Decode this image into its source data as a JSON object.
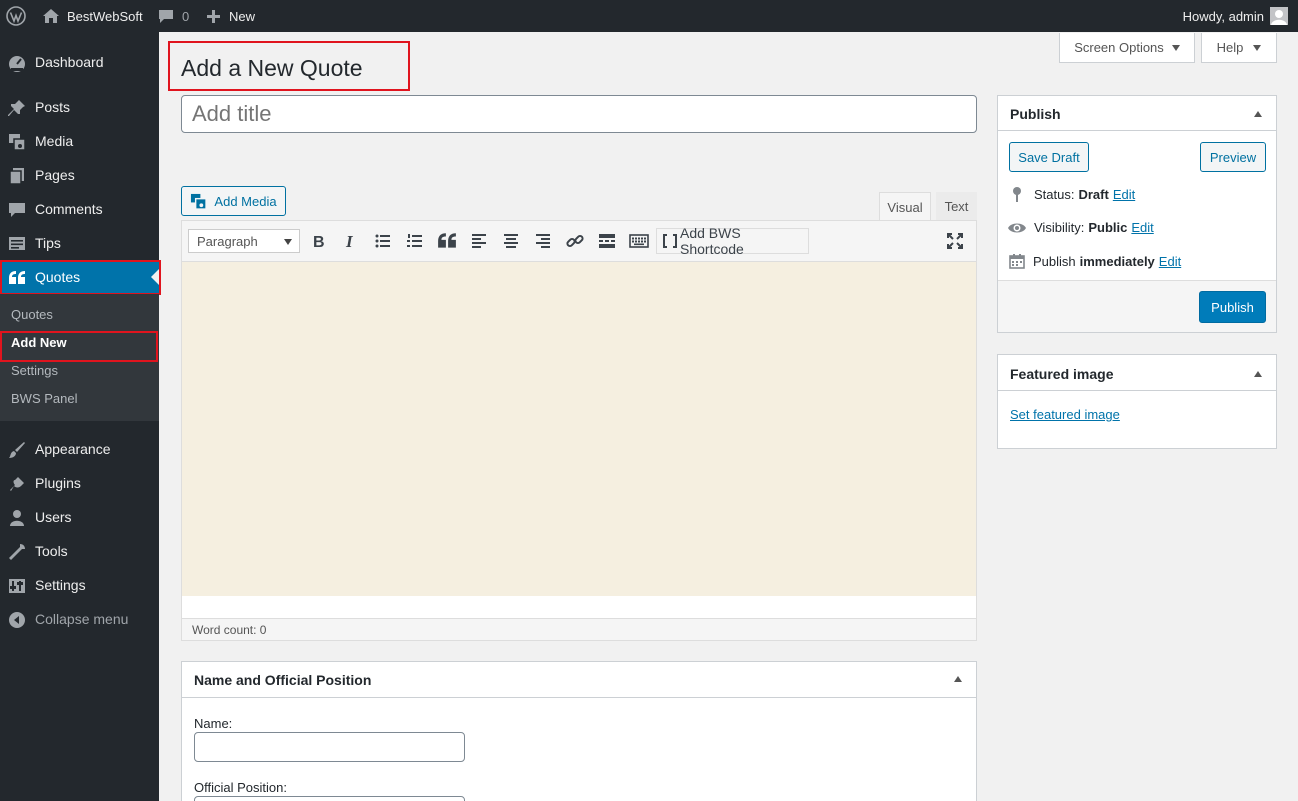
{
  "adminbar": {
    "site_name": "BestWebSoft",
    "comments_count": "0",
    "new_label": "New",
    "greeting": "Howdy, admin",
    "icons": [
      "wordpress-logo-icon",
      "home-icon",
      "comment-icon",
      "plus-icon",
      "avatar"
    ]
  },
  "sidebar": {
    "items": [
      {
        "label": "Dashboard",
        "icon": "dashboard-icon"
      },
      {
        "label": "Posts",
        "icon": "pin-icon"
      },
      {
        "label": "Media",
        "icon": "media-icon"
      },
      {
        "label": "Pages",
        "icon": "pages-icon"
      },
      {
        "label": "Comments",
        "icon": "comment-icon"
      },
      {
        "label": "Tips",
        "icon": "tips-icon"
      },
      {
        "label": "Quotes",
        "icon": "quote-icon",
        "active": true
      },
      {
        "label": "Appearance",
        "icon": "brush-icon"
      },
      {
        "label": "Plugins",
        "icon": "plugin-icon"
      },
      {
        "label": "Users",
        "icon": "user-icon"
      },
      {
        "label": "Tools",
        "icon": "wrench-icon"
      },
      {
        "label": "Settings",
        "icon": "settings-icon"
      },
      {
        "label": "Collapse menu",
        "icon": "collapse-icon"
      }
    ],
    "submenu": [
      "Quotes",
      "Add New",
      "Settings",
      "BWS Panel"
    ],
    "active_color": "#0073aa"
  },
  "header": {
    "page_title": "Add a New Quote",
    "screen_options": "Screen Options",
    "help": "Help"
  },
  "editor": {
    "title_placeholder": "Add title",
    "add_media": "Add Media",
    "tab_visual": "Visual",
    "tab_text": "Text",
    "format_select": "Paragraph",
    "shortcode": "Add BWS Shortcode",
    "word_count": "Word count: 0",
    "content_bg": "#f5efe0"
  },
  "publish_box": {
    "title": "Publish",
    "save_draft": "Save Draft",
    "preview": "Preview",
    "status_label": "Status:",
    "status_value": "Draft",
    "visibility_label": "Visibility:",
    "visibility_value": "Public",
    "publish_label": "Publish",
    "publish_value": "immediately",
    "edit": "Edit",
    "publish_button": "Publish"
  },
  "featured_box": {
    "title": "Featured image",
    "link": "Set featured image"
  },
  "name_box": {
    "title": "Name and Official Position",
    "name_label": "Name:",
    "position_label": "Official Position:"
  }
}
